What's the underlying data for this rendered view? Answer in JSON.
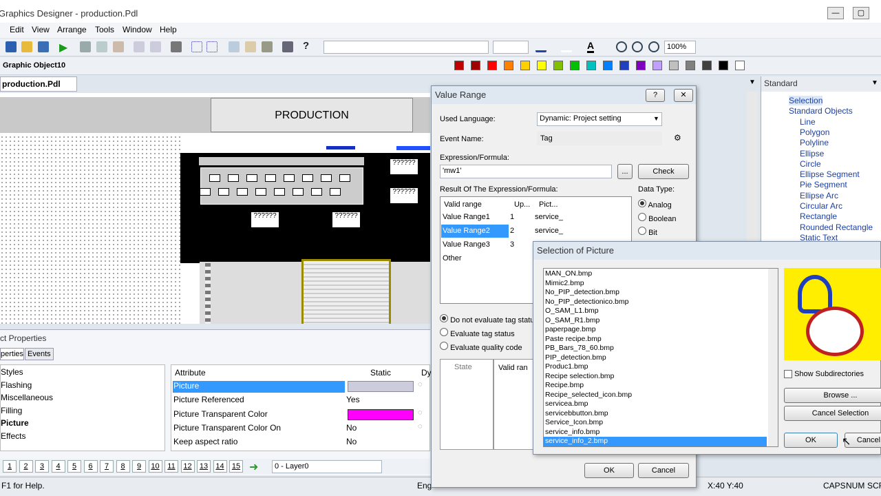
{
  "window": {
    "title": "Graphics Designer - production.Pdl"
  },
  "menu": [
    "Edit",
    "View",
    "Arrange",
    "Tools",
    "Window",
    "Help"
  ],
  "toolbar": {
    "zoom": "100%",
    "object_name": "Graphic Object10"
  },
  "palette": [
    "#c00000",
    "#a00000",
    "#ff0000",
    "#ff8000",
    "#ffd000",
    "#ffff00",
    "#80c000",
    "#00c000",
    "#00c0c0",
    "#0080ff",
    "#2040c0",
    "#8000c0",
    "#c0a0ff",
    "#c0c0c0",
    "#808080",
    "#404040",
    "#000000",
    "#ffffff"
  ],
  "document": {
    "tab": "production.Pdl",
    "close": "✕",
    "heading": "PRODUCTION",
    "placeholder": "??????"
  },
  "props": {
    "title": "ct Properties",
    "tab1": "perties",
    "tab2": "Events",
    "tree": [
      "Styles",
      "Flashing",
      "Miscellaneous",
      "Filling",
      "Picture",
      "Effects"
    ],
    "col_attr": "Attribute",
    "col_static": "Static",
    "col_dyn": "Dy",
    "rows": [
      {
        "a": "Picture",
        "v": ""
      },
      {
        "a": "Picture Referenced",
        "v": "Yes"
      },
      {
        "a": "Picture Transparent Color",
        "v": ""
      },
      {
        "a": "Picture Transparent Color On",
        "v": "No"
      },
      {
        "a": "Keep aspect ratio",
        "v": "No"
      }
    ]
  },
  "pages": [
    "1",
    "2",
    "3",
    "4",
    "5",
    "6",
    "7",
    "8",
    "9",
    "10",
    "11",
    "12",
    "13",
    "14",
    "15"
  ],
  "layer": "0 - Layer0",
  "status": {
    "help": "F1 for Help.",
    "lang": "Eng",
    "coords": "X:40 Y:40",
    "caps": "CAPS",
    "num": "NUM",
    "scr": "SCR"
  },
  "right": {
    "title": "Standard",
    "items": [
      "Selection",
      "Standard Objects",
      "Line",
      "Polygon",
      "Polyline",
      "Ellipse",
      "Circle",
      "Ellipse Segment",
      "Pie Segment",
      "Ellipse Arc",
      "Circular Arc",
      "Rectangle",
      "Rounded Rectangle",
      "Static Text"
    ]
  },
  "value_range": {
    "title": "Value Range",
    "help": "?",
    "close": "✕",
    "used_language_label": "Used Language:",
    "used_language": "Dynamic: Project setting",
    "event_name_label": "Event Name:",
    "event_name": "Tag",
    "expr_label": "Expression/Formula:",
    "expr": "'mw1'",
    "browse": "...",
    "check": "Check",
    "result_label": "Result Of The Expression/Formula:",
    "cols": [
      "Valid range",
      "Up...",
      "Pict..."
    ],
    "rows": [
      {
        "r": "Value Range1",
        "u": "1",
        "p": "service_"
      },
      {
        "r": "Value Range2",
        "u": "2",
        "p": "service_"
      },
      {
        "r": "Value Range3",
        "u": "3",
        "p": ""
      },
      {
        "r": "Other",
        "u": "",
        "p": ""
      }
    ],
    "datatype_label": "Data Type:",
    "datatypes": [
      "Analog",
      "Boolean",
      "Bit"
    ],
    "eval": [
      "Do not evaluate tag status",
      "Evaluate tag status",
      "Evaluate quality code"
    ],
    "state": "State",
    "valid": "Valid ran",
    "ok": "OK",
    "cancel": "Cancel"
  },
  "picture": {
    "title": "Selection of Picture",
    "files": [
      "MAN_ON.bmp",
      "Mimic2.bmp",
      "No_PIP_detection.bmp",
      "No_PIP_detectionico.bmp",
      "O_SAM_L1.bmp",
      "O_SAM_R1.bmp",
      "paperpage.bmp",
      "Paste recipe.bmp",
      "PB_Bars_78_60.bmp",
      "PIP_detection.bmp",
      "Produc1.bmp",
      "Recipe selection.bmp",
      "Recipe.bmp",
      "Recipe_selected_icon.bmp",
      "servicea.bmp",
      "servicebbutton.bmp",
      "Service_Icon.bmp",
      "service_info.bmp",
      "service_info_2.bmp"
    ],
    "show_sub": "Show Subdirectories",
    "browse": "Browse ...",
    "cancel_sel": "Cancel Selection",
    "ok": "OK",
    "cancel": "Cancel"
  }
}
